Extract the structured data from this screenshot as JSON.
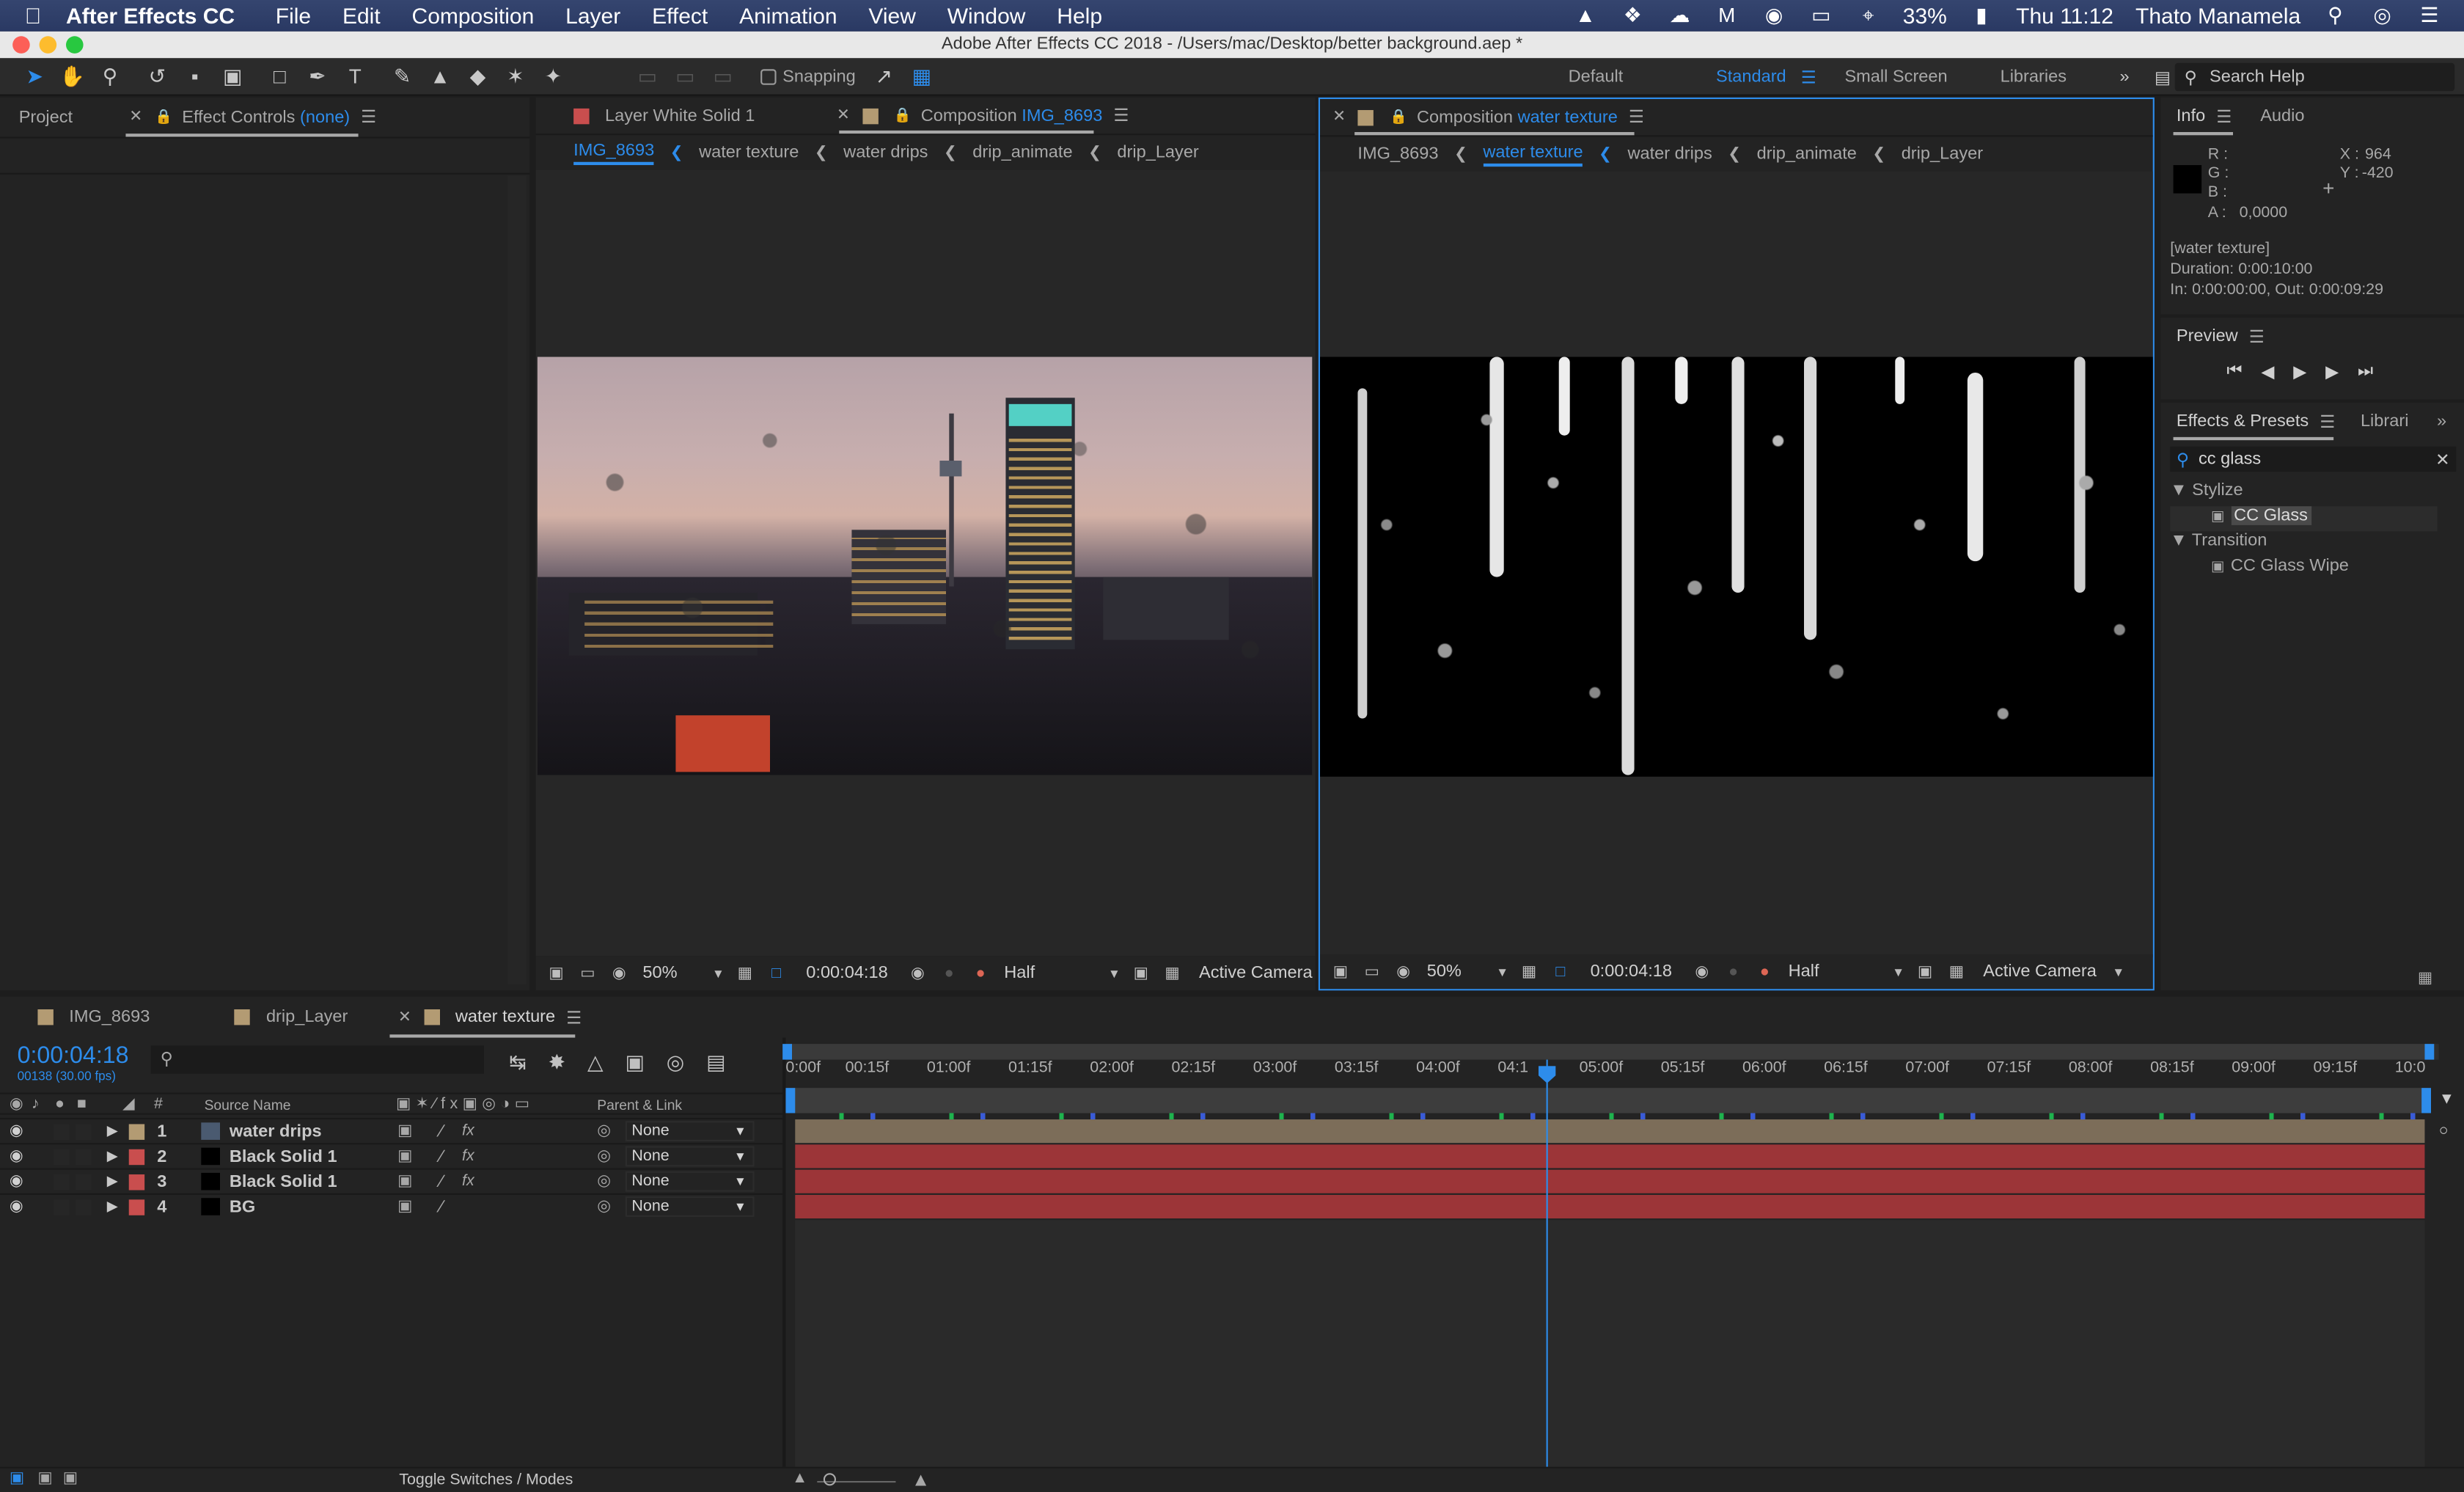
{
  "menubar": {
    "app_name": "After Effects CC",
    "items": [
      "File",
      "Edit",
      "Composition",
      "Layer",
      "Effect",
      "Animation",
      "View",
      "Window",
      "Help"
    ],
    "battery": "33%",
    "clock": "Thu 11:12",
    "user": "Thato Manamela"
  },
  "titlebar": {
    "title": "Adobe After Effects CC 2018 - /Users/mac/Desktop/better background.aep *"
  },
  "toolbar": {
    "snapping_label": "Snapping",
    "workspaces": [
      "Default",
      "Standard",
      "Small Screen",
      "Libraries"
    ],
    "active_workspace": "Standard",
    "search_placeholder": "Search Help"
  },
  "left_panel": {
    "project_tab": "Project",
    "effect_controls_label": "Effect Controls",
    "effect_controls_target": "(none)"
  },
  "viewer_left": {
    "tab1": "Layer White Solid 1",
    "tab2_prefix": "Composition",
    "tab2_name": "IMG_8693",
    "crumbs": [
      "IMG_8693",
      "water texture",
      "water drips",
      "drip_animate",
      "drip_Layer"
    ],
    "active_crumb": "IMG_8693",
    "zoom": "50%",
    "timecode": "0:00:04:18",
    "resolution": "Half",
    "camera": "Active Camera"
  },
  "viewer_right": {
    "tab_prefix": "Composition",
    "tab_name": "water texture",
    "crumbs": [
      "IMG_8693",
      "water texture",
      "water drips",
      "drip_animate",
      "drip_Layer"
    ],
    "active_crumb": "water texture",
    "zoom": "50%",
    "timecode": "0:00:04:18",
    "resolution": "Half",
    "camera": "Active Camera"
  },
  "info_panel": {
    "tab_info": "Info",
    "tab_audio": "Audio",
    "r_label": "R :",
    "g_label": "G :",
    "b_label": "B :",
    "a_label": "A :",
    "a_value": "0,0000",
    "x_label": "X :",
    "x_value": "964",
    "y_label": "Y :",
    "y_value": "-420",
    "layer_name": "[water texture]",
    "duration": "Duration: 0:00:10:00",
    "in_out": "In: 0:00:00:00, Out: 0:00:09:29"
  },
  "preview_panel": {
    "title": "Preview"
  },
  "effects_panel": {
    "tab_effects": "Effects & Presets",
    "tab_libraries": "Librari",
    "search_value": "cc glass",
    "groups": [
      {
        "name": "Stylize",
        "items": [
          "CC Glass"
        ]
      },
      {
        "name": "Transition",
        "items": [
          "CC Glass Wipe"
        ]
      }
    ]
  },
  "timeline": {
    "tabs": [
      "IMG_8693",
      "drip_Layer",
      "water texture"
    ],
    "active_tab": "water texture",
    "timecode": "0:00:04:18",
    "frame_info": "00138 (30.00 fps)",
    "col_hash": "#",
    "col_source": "Source Name",
    "col_parent": "Parent & Link",
    "ruler": [
      "0:00f",
      "00:15f",
      "01:00f",
      "01:15f",
      "02:00f",
      "02:15f",
      "03:00f",
      "03:15f",
      "04:00f",
      "04:1",
      "05:00f",
      "05:15f",
      "06:00f",
      "06:15f",
      "07:00f",
      "07:15f",
      "08:00f",
      "08:15f",
      "09:00f",
      "09:15f",
      "10:0"
    ],
    "layers": [
      {
        "num": "1",
        "name": "water drips",
        "parent": "None",
        "label_color": "#b39b73",
        "fx": true
      },
      {
        "num": "2",
        "name": "Black Solid 1",
        "parent": "None",
        "label_color": "#c94e4e",
        "fx": true
      },
      {
        "num": "3",
        "name": "Black Solid 1",
        "parent": "None",
        "label_color": "#c94e4e",
        "fx": true
      },
      {
        "num": "4",
        "name": "BG",
        "parent": "None",
        "label_color": "#c94e4e",
        "fx": false
      }
    ],
    "toggle_label": "Toggle Switches / Modes"
  },
  "colors": {
    "accent": "#2d8ceb",
    "bar_tan": "#7c6d59",
    "bar_red": "#9c3538"
  }
}
